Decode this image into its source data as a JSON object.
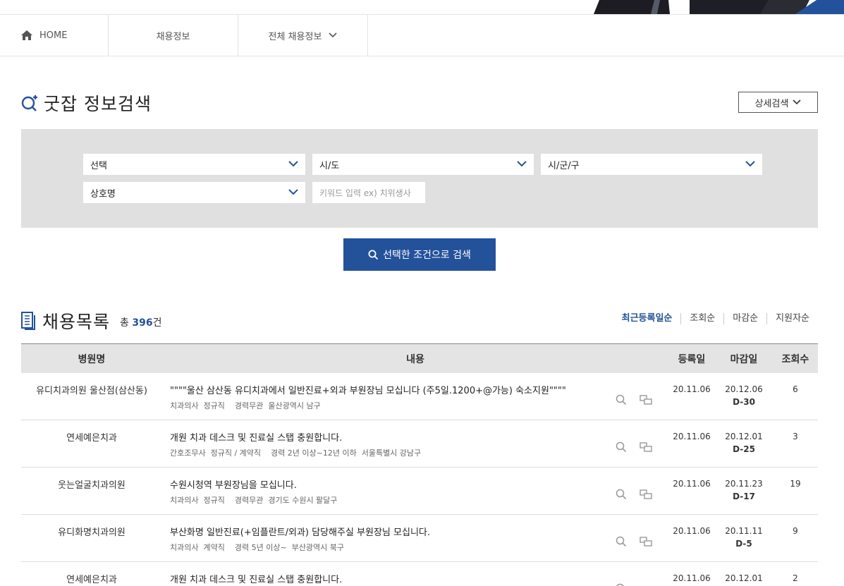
{
  "nav": {
    "home": "HOME",
    "recruit": "채용정보",
    "all_recruit": "전체 채용정보"
  },
  "search": {
    "title": "굿잡 정보검색",
    "detail_button": "상세검색",
    "select1": "선택",
    "select2": "시/도",
    "select3": "시/군/구",
    "select4": "상호명",
    "keyword_placeholder": "키워드 입력 ex) 치위생사",
    "submit": "선택한 조건으로 검색"
  },
  "list": {
    "title": "채용목록",
    "total_prefix": "총",
    "total_count": "396",
    "total_suffix": "건",
    "sort_options": [
      "최근등록일순",
      "조회순",
      "마감순",
      "지원자순"
    ],
    "columns": [
      "병원명",
      "내용",
      "등록일",
      "마감일",
      "조회수"
    ],
    "rows": [
      {
        "name": "유디치과의원 울산점(삼산동)",
        "title": "\"\"\"\"울산 삼산동 유디치과에서 일반진료+외과 부원장님 모십니다 (주5일.1200+@가능) 숙소지원\"\"\"\"",
        "job": "치과의사",
        "type": "정규직",
        "career": "경력무관",
        "location": "울산광역시 남구",
        "reg": "20.11.06",
        "due": "20.12.06",
        "dday": "D-30",
        "views": "6"
      },
      {
        "name": "연세예은치과",
        "title": "개원 치과 데스크 및 진료실 스탭 충원합니다.",
        "job": "간호조무사",
        "type": "정규직 / 계약직",
        "career": "경력 2년 이상~12년 이하",
        "location": "서울특별시 강남구",
        "reg": "20.11.06",
        "due": "20.12.01",
        "dday": "D-25",
        "views": "3"
      },
      {
        "name": "웃는얼굴치과의원",
        "title": "수원시청역 부원장님을 모십니다.",
        "job": "치과의사",
        "type": "정규직",
        "career": "경력무관",
        "location": "경기도 수원시 팔달구",
        "reg": "20.11.06",
        "due": "20.11.23",
        "dday": "D-17",
        "views": "19"
      },
      {
        "name": "유디화명치과의원",
        "title": "부산화명 일반진료(+임플란트/외과) 담당해주실 부원장님 모십니다.",
        "job": "치과의사",
        "type": "계약직",
        "career": "경력 5년 이상~",
        "location": "부산광역시 북구",
        "reg": "20.11.06",
        "due": "20.11.11",
        "dday": "D-5",
        "views": "9"
      },
      {
        "name": "연세예은치과",
        "title": "개원 치과 데스크 및 진료실 스탭 충원합니다.",
        "job": "",
        "type": "",
        "career": "",
        "location": "",
        "reg": "20.11.06",
        "due": "20.12.01",
        "dday": "",
        "views": "2"
      }
    ]
  }
}
